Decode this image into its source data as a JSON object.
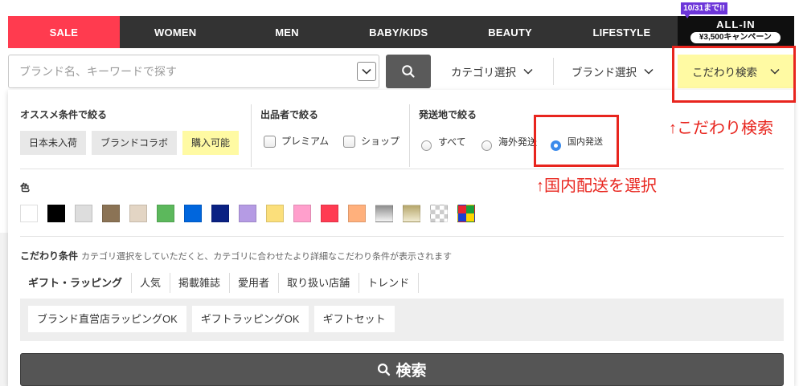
{
  "theme": {
    "sale_red": "#ff3b4f",
    "highlight_yellow": "#fffaa3",
    "annotation_red": "#e8251e",
    "radio_blue": "#3b8beb",
    "promo_purple": "#6c35d9"
  },
  "nav": {
    "tabs": [
      {
        "label": "SALE"
      },
      {
        "label": "WOMEN"
      },
      {
        "label": "MEN"
      },
      {
        "label": "BABY/KIDS"
      },
      {
        "label": "BEAUTY"
      },
      {
        "label": "LIFESTYLE"
      }
    ],
    "promo": {
      "badge": "10/31まで!!",
      "title": "ALL-IN",
      "pill": "¥3,500キャンペーン"
    }
  },
  "search": {
    "placeholder": "ブランド名、キーワードで探す",
    "value": "",
    "submit_icon": "search-icon",
    "category_label": "カテゴリ選択",
    "brand_label": "ブランド選択",
    "kodawari_label": "こだわり検索"
  },
  "filters": {
    "recommended": {
      "heading": "オススメ条件で絞る",
      "chips": [
        {
          "label": "日本未入荷",
          "active": false
        },
        {
          "label": "ブランドコラボ",
          "active": false
        },
        {
          "label": "購入可能",
          "active": true
        }
      ]
    },
    "seller": {
      "heading": "出品者で絞る",
      "options": [
        {
          "label": "プレミアム",
          "checked": false
        },
        {
          "label": "ショップ",
          "checked": false
        }
      ]
    },
    "shipping": {
      "heading": "発送地で絞る",
      "options": [
        {
          "label": "すべて",
          "checked": false
        },
        {
          "label": "海外発送",
          "checked": false
        },
        {
          "label": "国内発送",
          "checked": true
        }
      ]
    }
  },
  "colors": {
    "heading": "色",
    "swatches": [
      {
        "fill": [
          "#ffffff"
        ]
      },
      {
        "fill": [
          "#000000"
        ]
      },
      {
        "fill": [
          "#dddddd"
        ]
      },
      {
        "fill": [
          "#8b7355"
        ]
      },
      {
        "fill": [
          "#e3d5c4"
        ]
      },
      {
        "fill": [
          "#5cb85c"
        ]
      },
      {
        "fill": [
          "#0066dd"
        ]
      },
      {
        "fill": [
          "#0a2183"
        ]
      },
      {
        "fill": [
          "#b59be4"
        ]
      },
      {
        "fill": [
          "#fbdf7b"
        ]
      },
      {
        "fill": [
          "#ff9fcc"
        ]
      },
      {
        "fill": [
          "#ff3b52"
        ]
      },
      {
        "fill": [
          "#ffb07c"
        ]
      },
      {
        "pattern": "gradient",
        "fill": [
          "#8c8c8c",
          "#f4f4f4"
        ]
      },
      {
        "pattern": "gradient",
        "fill": [
          "#b5a66a",
          "#f2ecd2"
        ]
      },
      {
        "pattern": "checker",
        "fill": [
          "#cccccc",
          "#ffffff"
        ]
      },
      {
        "pattern": "quad",
        "fill": [
          "#e8252f",
          "#1a9e3a",
          "#1a3fd0",
          "#ffd400"
        ]
      }
    ]
  },
  "kodawari": {
    "heading": "こだわり条件",
    "hint": "カテゴリ選択をしていただくと、カテゴリに合わせたより詳細なこだわり条件が表示されます",
    "tabs": [
      {
        "label": "ギフト・ラッピング",
        "active": true
      },
      {
        "label": "人気",
        "active": false
      },
      {
        "label": "掲載雑誌",
        "active": false
      },
      {
        "label": "愛用者",
        "active": false
      },
      {
        "label": "取り扱い店舗",
        "active": false
      },
      {
        "label": "トレンド",
        "active": false
      }
    ],
    "options": [
      {
        "label": "ブランド直営店ラッピングOK"
      },
      {
        "label": "ギフトラッピングOK"
      },
      {
        "label": "ギフトセット"
      }
    ]
  },
  "submit": {
    "label": "検索",
    "icon": "search-icon"
  },
  "annotations": {
    "kodawari_note": "↑こだわり検索",
    "domestic_note": "↑国内配送を選択"
  }
}
